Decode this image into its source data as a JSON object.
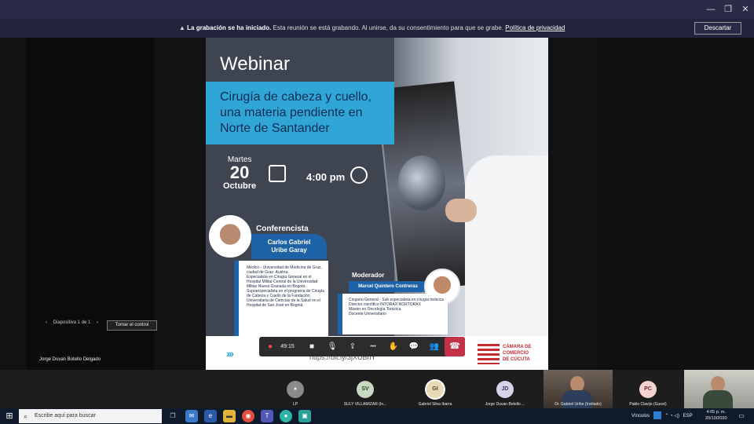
{
  "window": {
    "minimize": "—",
    "restore": "❐",
    "close": "✕"
  },
  "banner": {
    "title": "La grabación se ha iniciado.",
    "text": " Esta reunión se está grabando. Al unirse, da su consentimiento para que se grabe. ",
    "link": "Política de privacidad",
    "dismiss": "Descartar"
  },
  "share": {
    "slide_label": "Diapositiva 1 de 1",
    "take_control": "Tomar el control",
    "presenter": "Jorge Duvan Botello Delgado"
  },
  "slide": {
    "heading": "Webinar",
    "topic_line1": "Cirugía de cabeza y cuello,",
    "topic_line2": "una materia pendiente en",
    "topic_line3": "Norte de Santander",
    "weekday": "Martes",
    "day": "20",
    "month": "Octubre",
    "time": "4:00 pm",
    "speaker_heading": "Conferencista",
    "speaker_name1": "Carlos Gabriel",
    "speaker_name2": "Uribe Garay",
    "speaker_bio": [
      "Médico - Universidad de Medicina de Graz, ciudad de Graz- Austria.",
      "Especialista en Cirugía General en el Hospital Militar Central de la Universidad Militar Nueva Granada en Bogotá.",
      "Supraespecialista en el programa de Cirugía de Cabeza y Cuello de la Fundación Universitaria de Ciencias de la Salud en el Hospital de San José en Bogotá."
    ],
    "moderator_heading": "Moderador",
    "moderator_name": "Marcel Quintero Contreras",
    "moderator_bio": [
      "Cirujano General - Sub especialista en cirugía torácica",
      "Director científico INTORAX-NORTORAX",
      "Máster en Oncología Torácica",
      "Docente Universitario"
    ],
    "link": "https://bit.ly/3jXUBhY",
    "arrows": "›››",
    "logo_line1": "CÁMARA DE",
    "logo_line2": "COMERCIO",
    "logo_line3": "DE CÚCUTA"
  },
  "callbar": {
    "timer": "49:15",
    "rec_icon": "●",
    "camera_icon": "■",
    "mic_icon": "🎙",
    "share_icon": "⇪",
    "more_icon": "•••",
    "hand_icon": "✋",
    "chat_icon": "💬",
    "people_icon": "👥",
    "hangup_icon": "☎"
  },
  "participants": [
    {
      "initials": "",
      "name": "LP",
      "color": "#8a8a8a"
    },
    {
      "initials": "SV",
      "name": "SULY VILLAMIZAR (In...",
      "color": "#c7d9c1"
    },
    {
      "initials": "GI",
      "name": "Gabriel Silva Ibarra",
      "color": "#e9d8b4"
    },
    {
      "initials": "JD",
      "name": "Jorge Duvan Botello ...",
      "color": "#d9d3e8"
    },
    {
      "initials": "",
      "name": "Dr. Gabriel Uribe (Invitado)",
      "color": ""
    },
    {
      "initials": "PC",
      "name": "Pablo Clavijo (Guest)",
      "color": "#f3d4d0"
    },
    {
      "initials": "",
      "name": "",
      "color": ""
    }
  ],
  "taskbar": {
    "search_placeholder": "Escribe aquí para buscar",
    "vinculos": "Vínculos",
    "lang": "ESP",
    "time": "4:05 p. m.",
    "date": "20/10/2020"
  }
}
